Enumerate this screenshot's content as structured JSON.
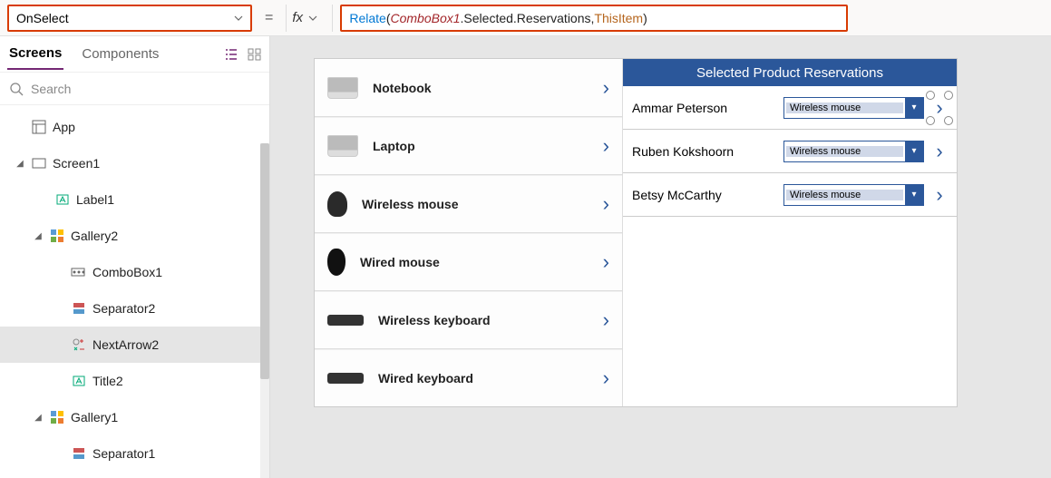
{
  "formulaBar": {
    "property": "OnSelect",
    "fx": "fx",
    "equals": "=",
    "formula_fn": "Relate",
    "formula_open": "( ",
    "formula_obj": "ComboBox1",
    "formula_dot": ".Selected.Reservations, ",
    "formula_this": "ThisItem",
    "formula_close": " )"
  },
  "tree": {
    "tabs": {
      "screens": "Screens",
      "components": "Components"
    },
    "search_placeholder": "Search",
    "items": {
      "app": "App",
      "screen1": "Screen1",
      "label1": "Label1",
      "gallery2": "Gallery2",
      "combobox1": "ComboBox1",
      "separator2": "Separator2",
      "nextarrow2": "NextArrow2",
      "title2": "Title2",
      "gallery1": "Gallery1",
      "separator1": "Separator1"
    }
  },
  "products": [
    {
      "name": "Notebook",
      "kind": "laptop"
    },
    {
      "name": "Laptop",
      "kind": "laptop"
    },
    {
      "name": "Wireless mouse",
      "kind": "mouse"
    },
    {
      "name": "Wired mouse",
      "kind": "mouse2"
    },
    {
      "name": "Wireless keyboard",
      "kind": "kbd"
    },
    {
      "name": "Wired keyboard",
      "kind": "kbd"
    }
  ],
  "rightPanel": {
    "header": "Selected Product Reservations",
    "comboValue": "Wireless mouse",
    "rows": [
      {
        "name": "Ammar Peterson",
        "value": "Wireless mouse",
        "selected": true
      },
      {
        "name": "Ruben Kokshoorn",
        "value": "Wireless mouse",
        "selected": false
      },
      {
        "name": "Betsy McCarthy",
        "value": "Wireless mouse",
        "selected": false
      }
    ]
  }
}
